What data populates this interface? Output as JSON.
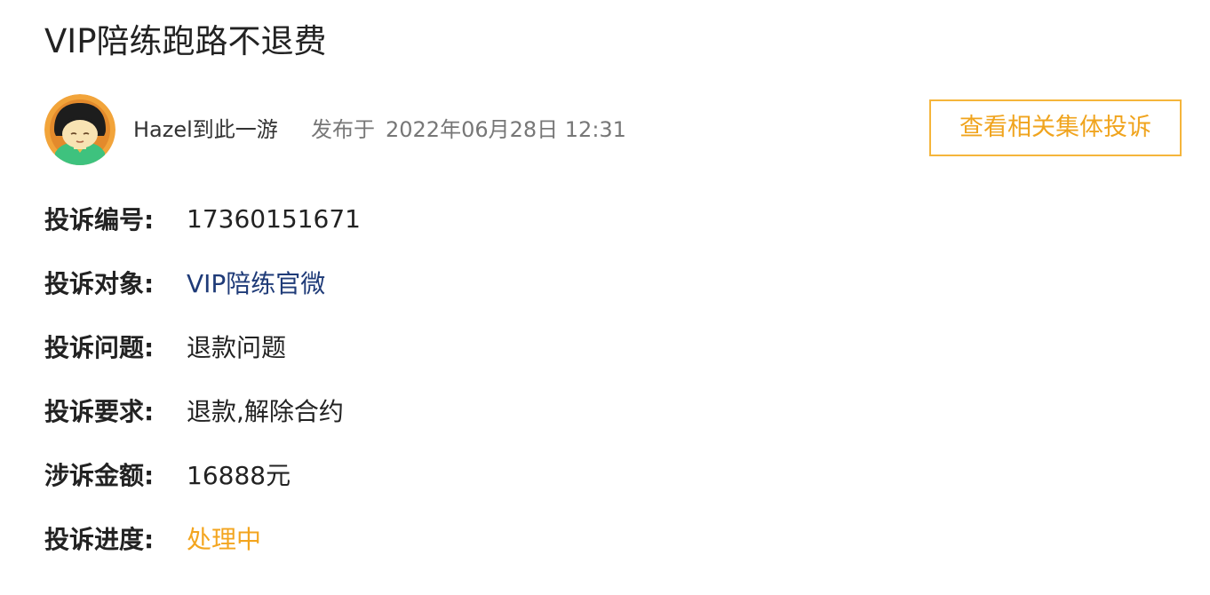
{
  "complaint": {
    "title": "VIP陪练跑路不退费",
    "author": "Hazel到此一游",
    "published_prefix": "发布于",
    "published_time": "2022年06月28日 12:31",
    "related_button": "查看相关集体投诉",
    "fields": [
      {
        "label": "投诉编号:",
        "value": "17360151671"
      },
      {
        "label": "投诉对象:",
        "value": "VIP陪练官微"
      },
      {
        "label": "投诉问题:",
        "value": "退款问题"
      },
      {
        "label": "投诉要求:",
        "value": "退款,解除合约"
      },
      {
        "label": "涉诉金额:",
        "value": "16888元"
      },
      {
        "label": "投诉进度:",
        "value": "处理中"
      }
    ]
  },
  "colors": {
    "accent": "#f0a41e",
    "link": "#1f3b78",
    "muted": "#777777"
  },
  "icons": {
    "avatar": "cartoon-person-avatar"
  }
}
